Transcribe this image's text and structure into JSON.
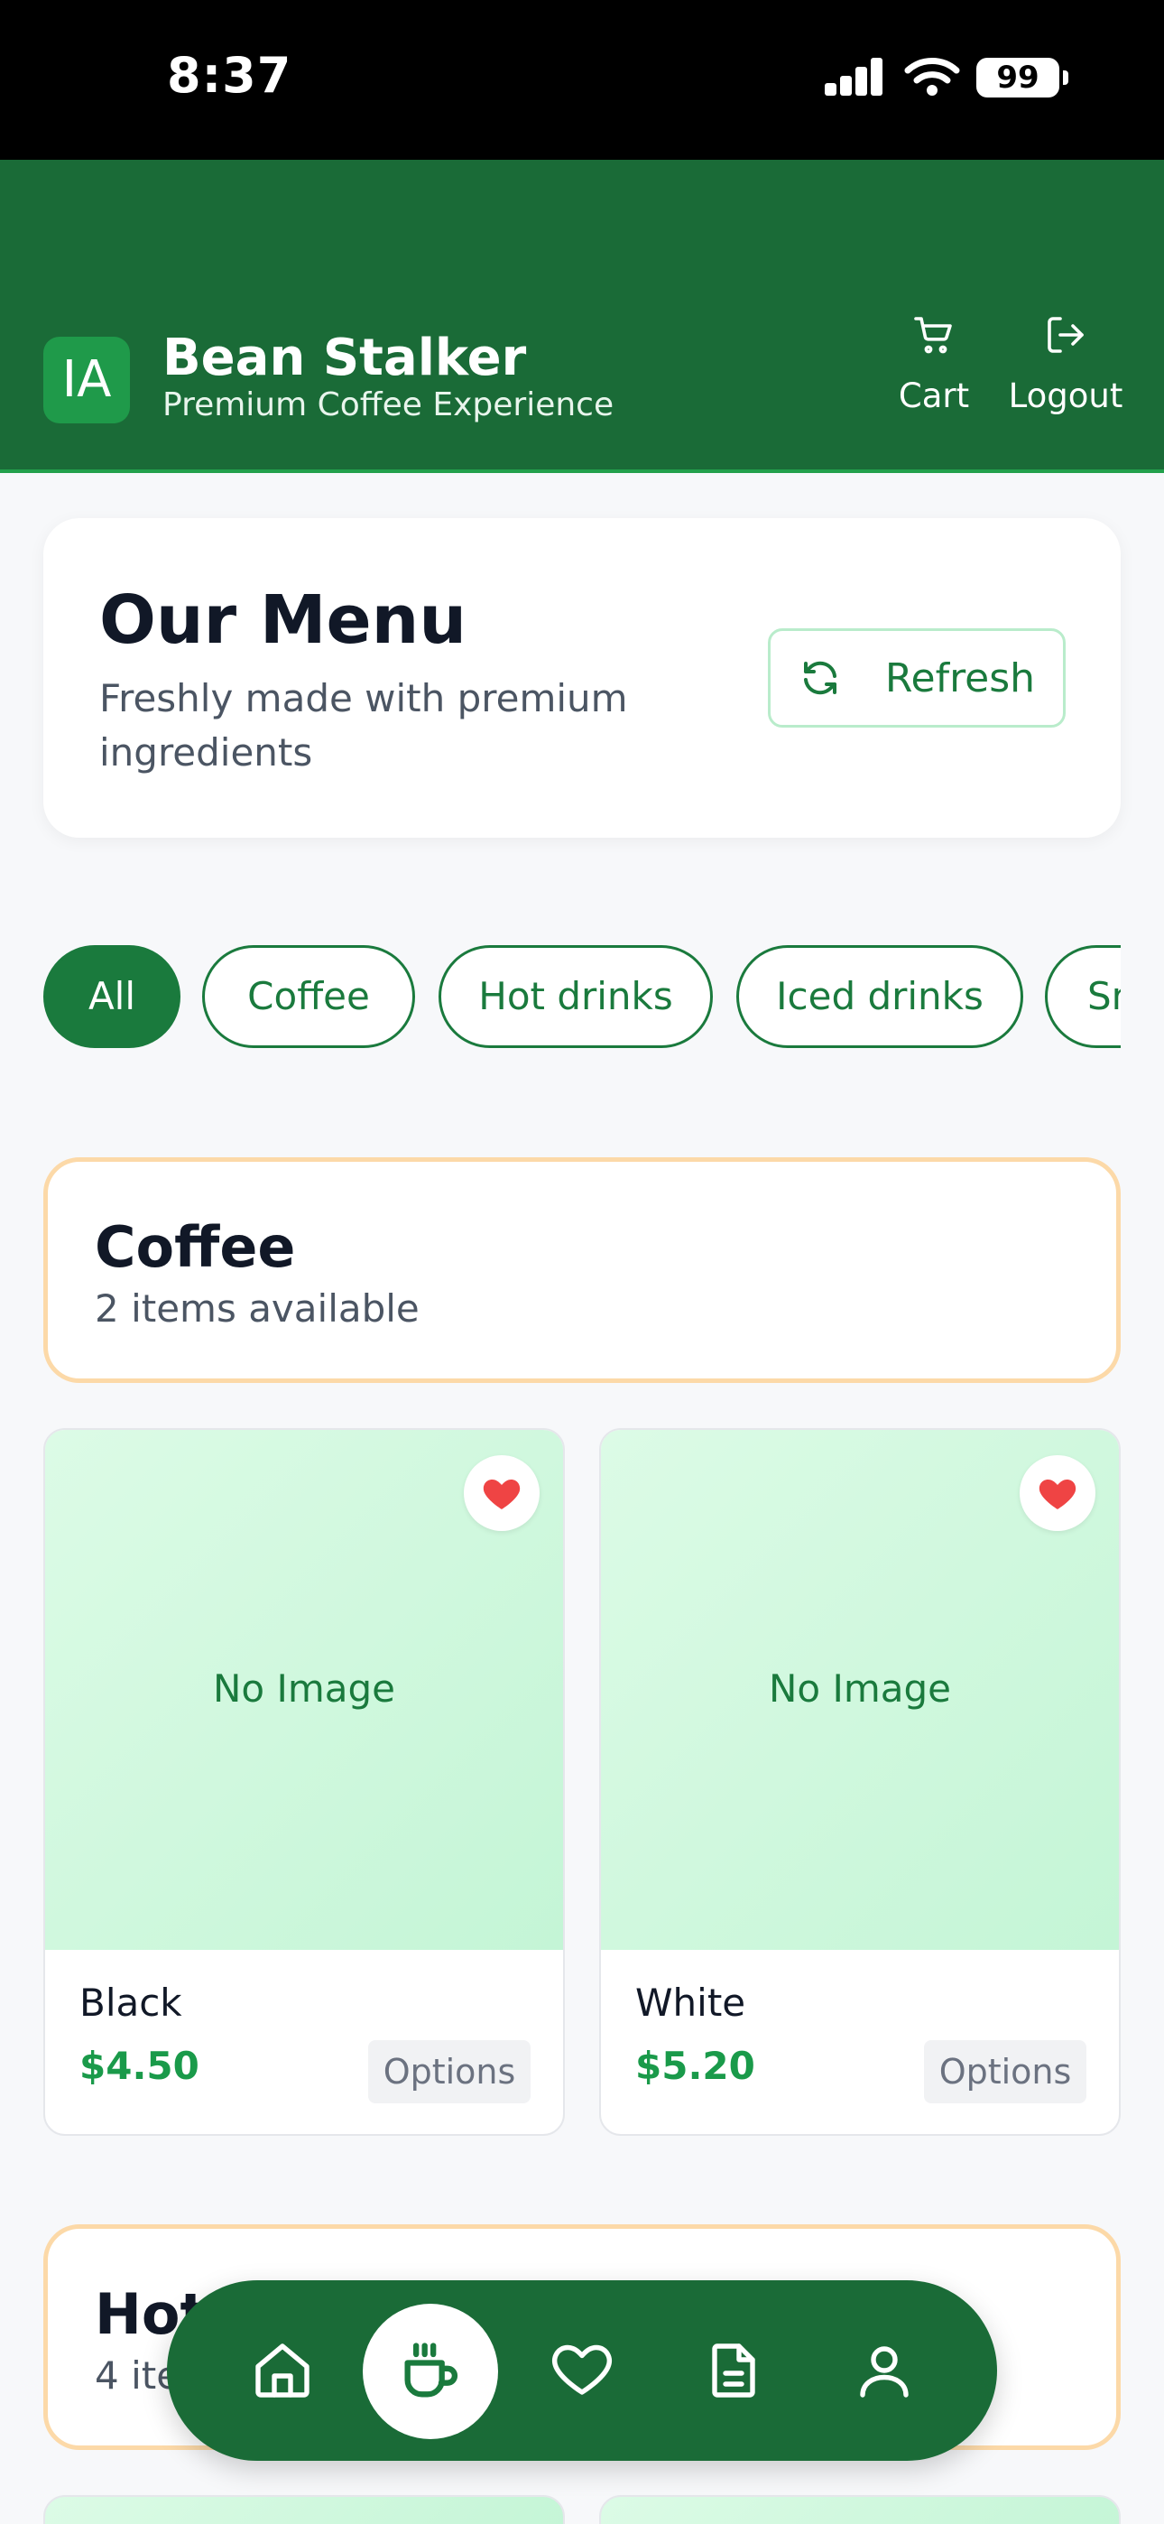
{
  "status_bar": {
    "time": "8:37",
    "battery": "99"
  },
  "header": {
    "logo_initials": "IA",
    "title": "Bean Stalker",
    "subtitle": "Premium Coffee Experience",
    "cart_label": "Cart",
    "logout_label": "Logout"
  },
  "menu": {
    "title": "Our Menu",
    "subtitle": "Freshly made with premium ingredients",
    "refresh_label": "Refresh"
  },
  "chips": [
    {
      "label": "All",
      "active": true
    },
    {
      "label": "Coffee",
      "active": false
    },
    {
      "label": "Hot drinks",
      "active": false
    },
    {
      "label": "Iced drinks",
      "active": false
    },
    {
      "label": "Sn",
      "active": false
    }
  ],
  "categories": [
    {
      "title": "Coffee",
      "count_text": "2 items available"
    },
    {
      "title": "Hot D",
      "count_text": "4 ite"
    }
  ],
  "products": [
    {
      "image_text": "No Image",
      "name": "Black",
      "price": "$4.50",
      "options_label": "Options"
    },
    {
      "image_text": "No Image",
      "name": "White",
      "price": "$5.20",
      "options_label": "Options"
    }
  ],
  "bottom_nav": [
    "home-icon",
    "coffee-cup-icon",
    "heart-icon",
    "document-icon",
    "user-icon"
  ],
  "colors": {
    "brand_green": "#1a6b37",
    "accent_green": "#1a9a4a",
    "heart_red": "#ef4444",
    "category_border": "#fcd9a8"
  }
}
